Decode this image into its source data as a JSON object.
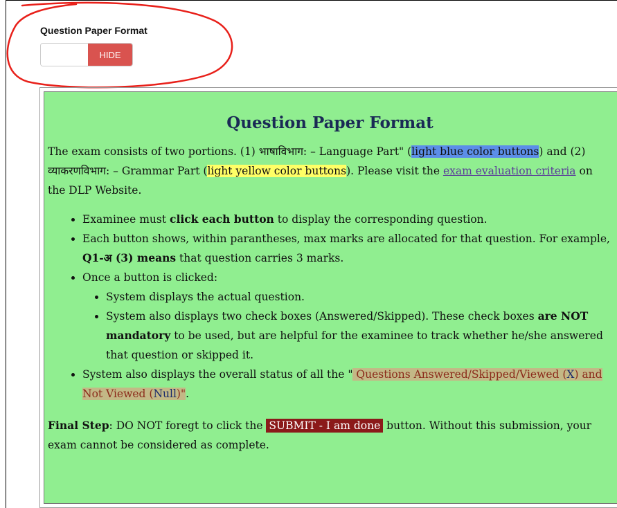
{
  "toggle": {
    "title": "Question Paper Format",
    "hide_label": "HIDE"
  },
  "panel": {
    "title": "Question Paper Format",
    "intro": {
      "t1": "The exam consists of two portions. (1) भाषाविभाग: – Language Part\" (",
      "hl_blue": "light blue color buttons",
      "t2": ") and (2) व्याकरणविभाग: – Grammar Part (",
      "hl_yellow": "light yellow color buttons",
      "t3": ").  Please visit the ",
      "link": "exam evaluation criteria",
      "t4": " on the DLP Website."
    },
    "bullets": {
      "b1_pre": "Examinee must ",
      "b1_bold": "click each button",
      "b1_post": " to display the corresponding question.",
      "b2_pre": "Each button shows, within parantheses, max marks are allocated for that question. For example, ",
      "b2_bold": "Q1-अ (3) means",
      "b2_post": " that question carries 3 marks.",
      "b3": "Once a button is clicked:",
      "s1": "System displays the actual question.",
      "s2_pre": "System also displays two check boxes (Answered/Skipped). These check boxes ",
      "s2_bold": "are NOT mandatory",
      "s2_post": " to be used, but are helpful for the examinee to track whether he/she answered that question or skipped it.",
      "b4_pre": "System also displays the overall status of all the \"",
      "b4_s1": " Questions Answered/Skipped/Viewed (",
      "b4_x": "X",
      "b4_s2": ") and Not Viewed (",
      "b4_null": "Null",
      "b4_s3": ")\"",
      "b4_post": "."
    },
    "final": {
      "label": "Final Step",
      "t1": ": DO NOT foregt to click the ",
      "submit": "SUBMIT - I am done",
      "t2": " button.  Without this submission, your exam cannot be considered as complete."
    }
  },
  "colors": {
    "panel_bg": "#90ee90",
    "hide_button": "#d9534f",
    "annotation": "#e8201a",
    "highlight_blue": "#5c8ee8",
    "highlight_yellow": "#ffff66",
    "submit_badge": "#8b1a1a"
  }
}
